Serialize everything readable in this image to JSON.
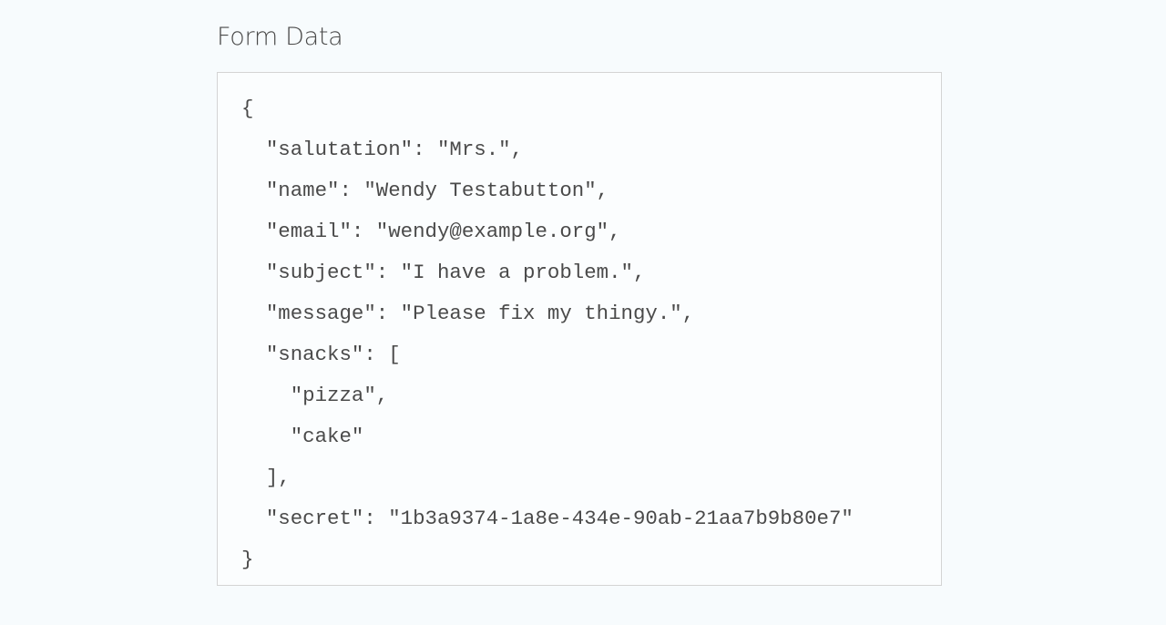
{
  "form_data": {
    "title": "Form Data",
    "lines": [
      "{",
      "  \"salutation\": \"Mrs.\",",
      "  \"name\": \"Wendy Testabutton\",",
      "  \"email\": \"wendy@example.org\",",
      "  \"subject\": \"I have a problem.\",",
      "  \"message\": \"Please fix my thingy.\",",
      "  \"snacks\": [",
      "    \"pizza\",",
      "    \"cake\"",
      "  ],",
      "  \"secret\": \"1b3a9374-1a8e-434e-90ab-21aa7b9b80e7\"",
      "}"
    ]
  }
}
